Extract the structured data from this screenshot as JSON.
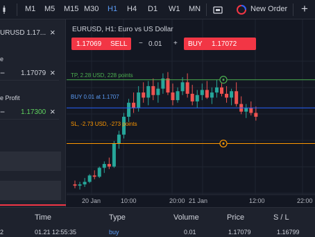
{
  "toolbar": {
    "timeframes": [
      "M1",
      "M5",
      "M15",
      "M30",
      "H1",
      "H4",
      "D1",
      "W1",
      "MN"
    ],
    "active_timeframe": "H1",
    "new_order_label": "New Order"
  },
  "order_panel": {
    "symbol": "URUSD 1.17...",
    "stop_label": "e",
    "stop_value": "1.17079",
    "take_label": "e Profit",
    "take_value": "1.17300"
  },
  "chart": {
    "title": "EURUSD, H1: Euro vs US Dollar",
    "sell_price": "1.17069",
    "sell_label": "SELL",
    "volume": "0.01",
    "buy_label": "BUY",
    "buy_price": "1.17072",
    "tp_label": "TP, 2.28 USD, 228 points",
    "buy_line_label": "BUY 0.01 at 1.1707",
    "sl_label": "SL, -2.73 USD, -273 points",
    "x_ticks": [
      "20 Jan",
      "10:00",
      "20:00",
      "21 Jan",
      "12:00",
      "22:00"
    ],
    "colors": {
      "up": "#26a69a",
      "down": "#ef5350",
      "tp": "#4caf50",
      "sl": "#ff9800",
      "buy": "#2962ff",
      "accent": "#f23645"
    }
  },
  "chart_data": {
    "type": "candlestick",
    "series": [
      {
        "values": [
          [
            1.1648,
            1.1651,
            1.1645,
            1.1647
          ],
          [
            1.1647,
            1.165,
            1.1644,
            1.1648
          ],
          [
            1.1648,
            1.1653,
            1.1646,
            1.165
          ],
          [
            1.165,
            1.1656,
            1.1649,
            1.1655
          ],
          [
            1.1655,
            1.1659,
            1.1652,
            1.1654
          ],
          [
            1.1654,
            1.1662,
            1.1653,
            1.1661
          ],
          [
            1.1661,
            1.1666,
            1.1657,
            1.1664
          ],
          [
            1.1664,
            1.1669,
            1.166,
            1.1662
          ],
          [
            1.1662,
            1.1682,
            1.1661,
            1.168
          ],
          [
            1.168,
            1.169,
            1.1676,
            1.1687
          ],
          [
            1.1687,
            1.1704,
            1.1684,
            1.1701
          ],
          [
            1.1701,
            1.1715,
            1.1697,
            1.1712
          ],
          [
            1.1712,
            1.172,
            1.1704,
            1.1708
          ],
          [
            1.1708,
            1.1725,
            1.1705,
            1.172
          ],
          [
            1.172,
            1.1728,
            1.1712,
            1.1716
          ],
          [
            1.1716,
            1.1729,
            1.171,
            1.1725
          ],
          [
            1.1725,
            1.1731,
            1.1714,
            1.1718
          ],
          [
            1.1718,
            1.1728,
            1.1712,
            1.1723
          ],
          [
            1.1723,
            1.1735,
            1.1719,
            1.1731
          ],
          [
            1.1731,
            1.1736,
            1.1718,
            1.172
          ],
          [
            1.172,
            1.1727,
            1.171,
            1.1714
          ],
          [
            1.1714,
            1.1724,
            1.1712,
            1.1721
          ],
          [
            1.1721,
            1.1732,
            1.1718,
            1.1728
          ],
          [
            1.1728,
            1.1735,
            1.1716,
            1.1719
          ],
          [
            1.1719,
            1.1726,
            1.171,
            1.1713
          ],
          [
            1.1713,
            1.1722,
            1.1708,
            1.1718
          ],
          [
            1.1718,
            1.1727,
            1.1714,
            1.1722
          ],
          [
            1.1722,
            1.1729,
            1.1715,
            1.1716
          ],
          [
            1.1716,
            1.1724,
            1.1711,
            1.172
          ],
          [
            1.172,
            1.173,
            1.1716,
            1.1724
          ],
          [
            1.1724,
            1.1731,
            1.1717,
            1.1719
          ],
          [
            1.1719,
            1.1725,
            1.1712,
            1.1716
          ],
          [
            1.1716,
            1.1723,
            1.171,
            1.1721
          ],
          [
            1.1721,
            1.1728,
            1.1709,
            1.1711
          ],
          [
            1.1711,
            1.1717,
            1.1703,
            1.1705
          ],
          [
            1.1705,
            1.1711,
            1.17,
            1.1708
          ],
          [
            1.1708,
            1.1713,
            1.1702,
            1.1704
          ],
          [
            1.1704,
            1.1709,
            1.1698,
            1.1701
          ]
        ]
      }
    ],
    "value_format": "[open, high, low, close]",
    "x_ticks": [
      "20 Jan",
      "10:00",
      "20:00",
      "21 Jan",
      "12:00",
      "22:00"
    ],
    "lines": [
      {
        "label": "TP, 2.28 USD, 228 points",
        "value": 1.173
      },
      {
        "label": "BUY 0.01 at 1.1707",
        "value": 1.17079
      },
      {
        "label": "SL, -2.73 USD, -273 points",
        "value": 1.168
      }
    ],
    "ylim": [
      1.164,
      1.175
    ],
    "grid": true
  },
  "positions": {
    "headers": [
      "Time",
      "Type",
      "Volume",
      "Price",
      "S / L"
    ],
    "row": {
      "ticket": "2",
      "time": "01.21 12:55:35",
      "type": "buy",
      "volume": "0.01",
      "price": "1.17079",
      "sl": "1.16799"
    }
  }
}
